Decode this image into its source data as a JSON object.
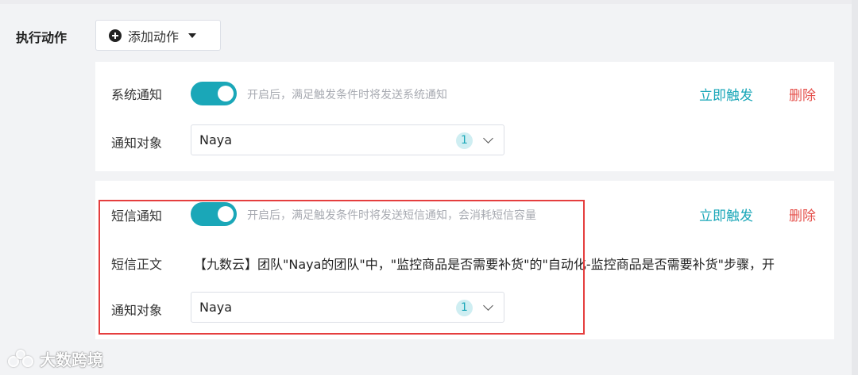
{
  "section": {
    "label": "执行动作"
  },
  "add_button": {
    "label": "添加动作",
    "icon": "plus-circle-icon"
  },
  "system_card": {
    "title": "系统通知",
    "toggle_on": true,
    "hint": "开启后，满足触发条件时将发送系统通知",
    "trigger_label": "立即触发",
    "delete_label": "删除",
    "target_label": "通知对象",
    "target_value": "Naya",
    "target_count": "1"
  },
  "sms_card": {
    "title": "短信通知",
    "toggle_on": true,
    "hint": "开启后，满足触发条件时将发送短信通知，会消耗短信容量",
    "trigger_label": "立即触发",
    "delete_label": "删除",
    "body_label": "短信正文",
    "body_text": "【九数云】团队\"Naya的团队\"中，\"监控商品是否需要补货\"的\"自动化-监控商品是否需要补货\"步骤，开",
    "target_label": "通知对象",
    "target_value": "Naya",
    "target_count": "1"
  },
  "watermark": {
    "text": "大数跨境"
  },
  "colors": {
    "accent": "#1aa7b8",
    "danger": "#e5504b",
    "highlight": "#e53e3e"
  }
}
